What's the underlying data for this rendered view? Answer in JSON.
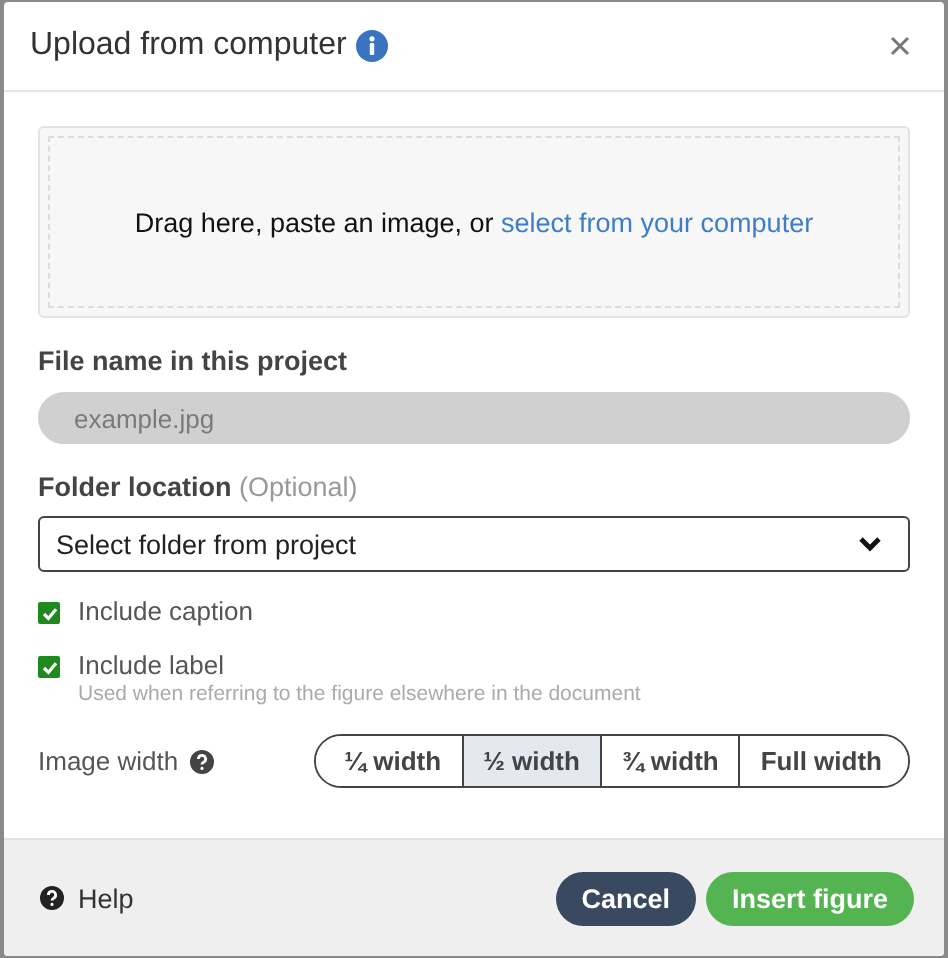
{
  "dialog": {
    "title": "Upload from computer"
  },
  "dropzone": {
    "text": "Drag here, paste an image, or",
    "link": "select from your computer"
  },
  "file_name": {
    "label": "File name in this project",
    "placeholder": "example.jpg",
    "disabled": true
  },
  "folder": {
    "label": "Folder location",
    "hint": "(Optional)",
    "value": "Select folder from project"
  },
  "options": [
    {
      "label": "Include caption",
      "checked": true
    },
    {
      "label": "Include label",
      "description": "Used when referring to the figure elsewhere in the document",
      "checked": true
    }
  ],
  "image_width": {
    "label": "Image width",
    "choices": [
      {
        "label": "¼ width",
        "selected": false
      },
      {
        "label": "½ width",
        "selected": true
      },
      {
        "label": "¾ width",
        "selected": false
      },
      {
        "label": "Full width",
        "selected": false
      }
    ]
  },
  "footer": {
    "help": "Help",
    "buttons": [
      {
        "label": "Cancel",
        "kind": "secondary"
      },
      {
        "label": "Insert figure",
        "kind": "primary"
      }
    ]
  }
}
